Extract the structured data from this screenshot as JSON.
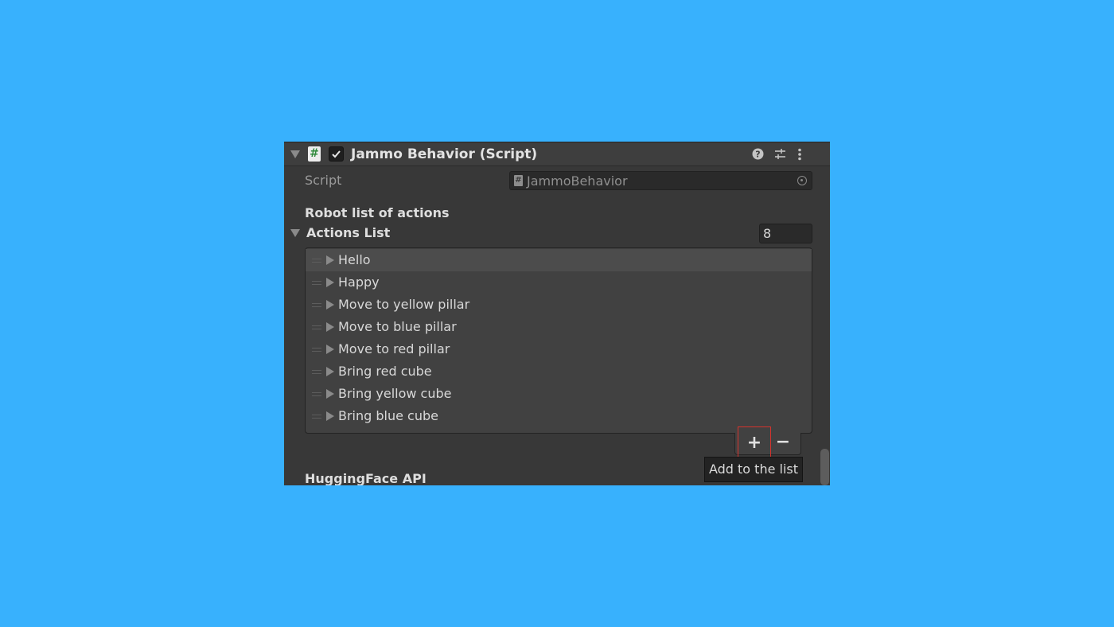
{
  "component": {
    "title": "Jammo Behavior (Script)",
    "enabled": true,
    "script_icon_glyph": "#",
    "header_icons": [
      "help-icon",
      "preset-sliders-icon",
      "kebab-menu-icon"
    ]
  },
  "fields": {
    "script_label": "Script",
    "script_value": "JammoBehavior",
    "script_value_icon_glyph": "#"
  },
  "sections": {
    "robot_header": "Robot list of actions",
    "actions_list_label": "Actions List",
    "actions_count": "8",
    "huggingface_header": "HuggingFace API"
  },
  "actions": [
    {
      "label": "Hello"
    },
    {
      "label": "Happy"
    },
    {
      "label": "Move to yellow pillar"
    },
    {
      "label": "Move to blue pillar"
    },
    {
      "label": "Move to red pillar"
    },
    {
      "label": "Bring red cube"
    },
    {
      "label": "Bring yellow cube"
    },
    {
      "label": "Bring blue cube"
    }
  ],
  "list_controls": {
    "add": "+",
    "remove": "−",
    "tooltip": "Add to the list"
  },
  "colors": {
    "background": "#38b1fd",
    "panel": "#383838",
    "highlight_outline": "#d6332c"
  }
}
